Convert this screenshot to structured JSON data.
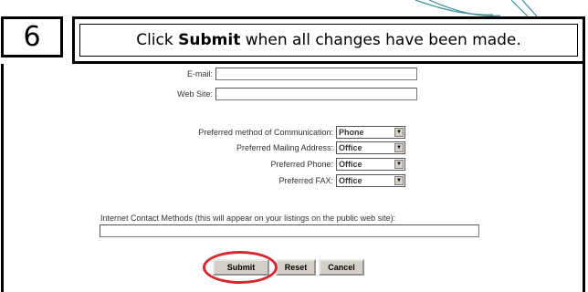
{
  "step": {
    "number": "6"
  },
  "instruction": {
    "prefix": "Click ",
    "emphasis": "Submit",
    "suffix": " when all changes have been made."
  },
  "form": {
    "email": {
      "label": "E-mail:",
      "value": ""
    },
    "website": {
      "label": "Web Site:",
      "value": ""
    },
    "preferred_communication": {
      "label": "Preferred method of Communication:",
      "selected": "Phone"
    },
    "preferred_mailing_address": {
      "label": "Preferred Mailing Address:",
      "selected": "Office"
    },
    "preferred_phone": {
      "label": "Preferred Phone:",
      "selected": "Office"
    },
    "preferred_fax": {
      "label": "Preferred FAX:",
      "selected": "Office"
    },
    "internet_contact": {
      "label": "Internet Contact Methods (this will appear on your listings on the public web site):",
      "value": ""
    },
    "buttons": {
      "submit": "Submit",
      "reset": "Reset",
      "cancel": "Cancel"
    }
  },
  "colors": {
    "highlight_ring": "#d8262e",
    "decor_curve": "#3a8f9a"
  },
  "icons": {
    "select_arrow": "chevron-down-icon"
  }
}
